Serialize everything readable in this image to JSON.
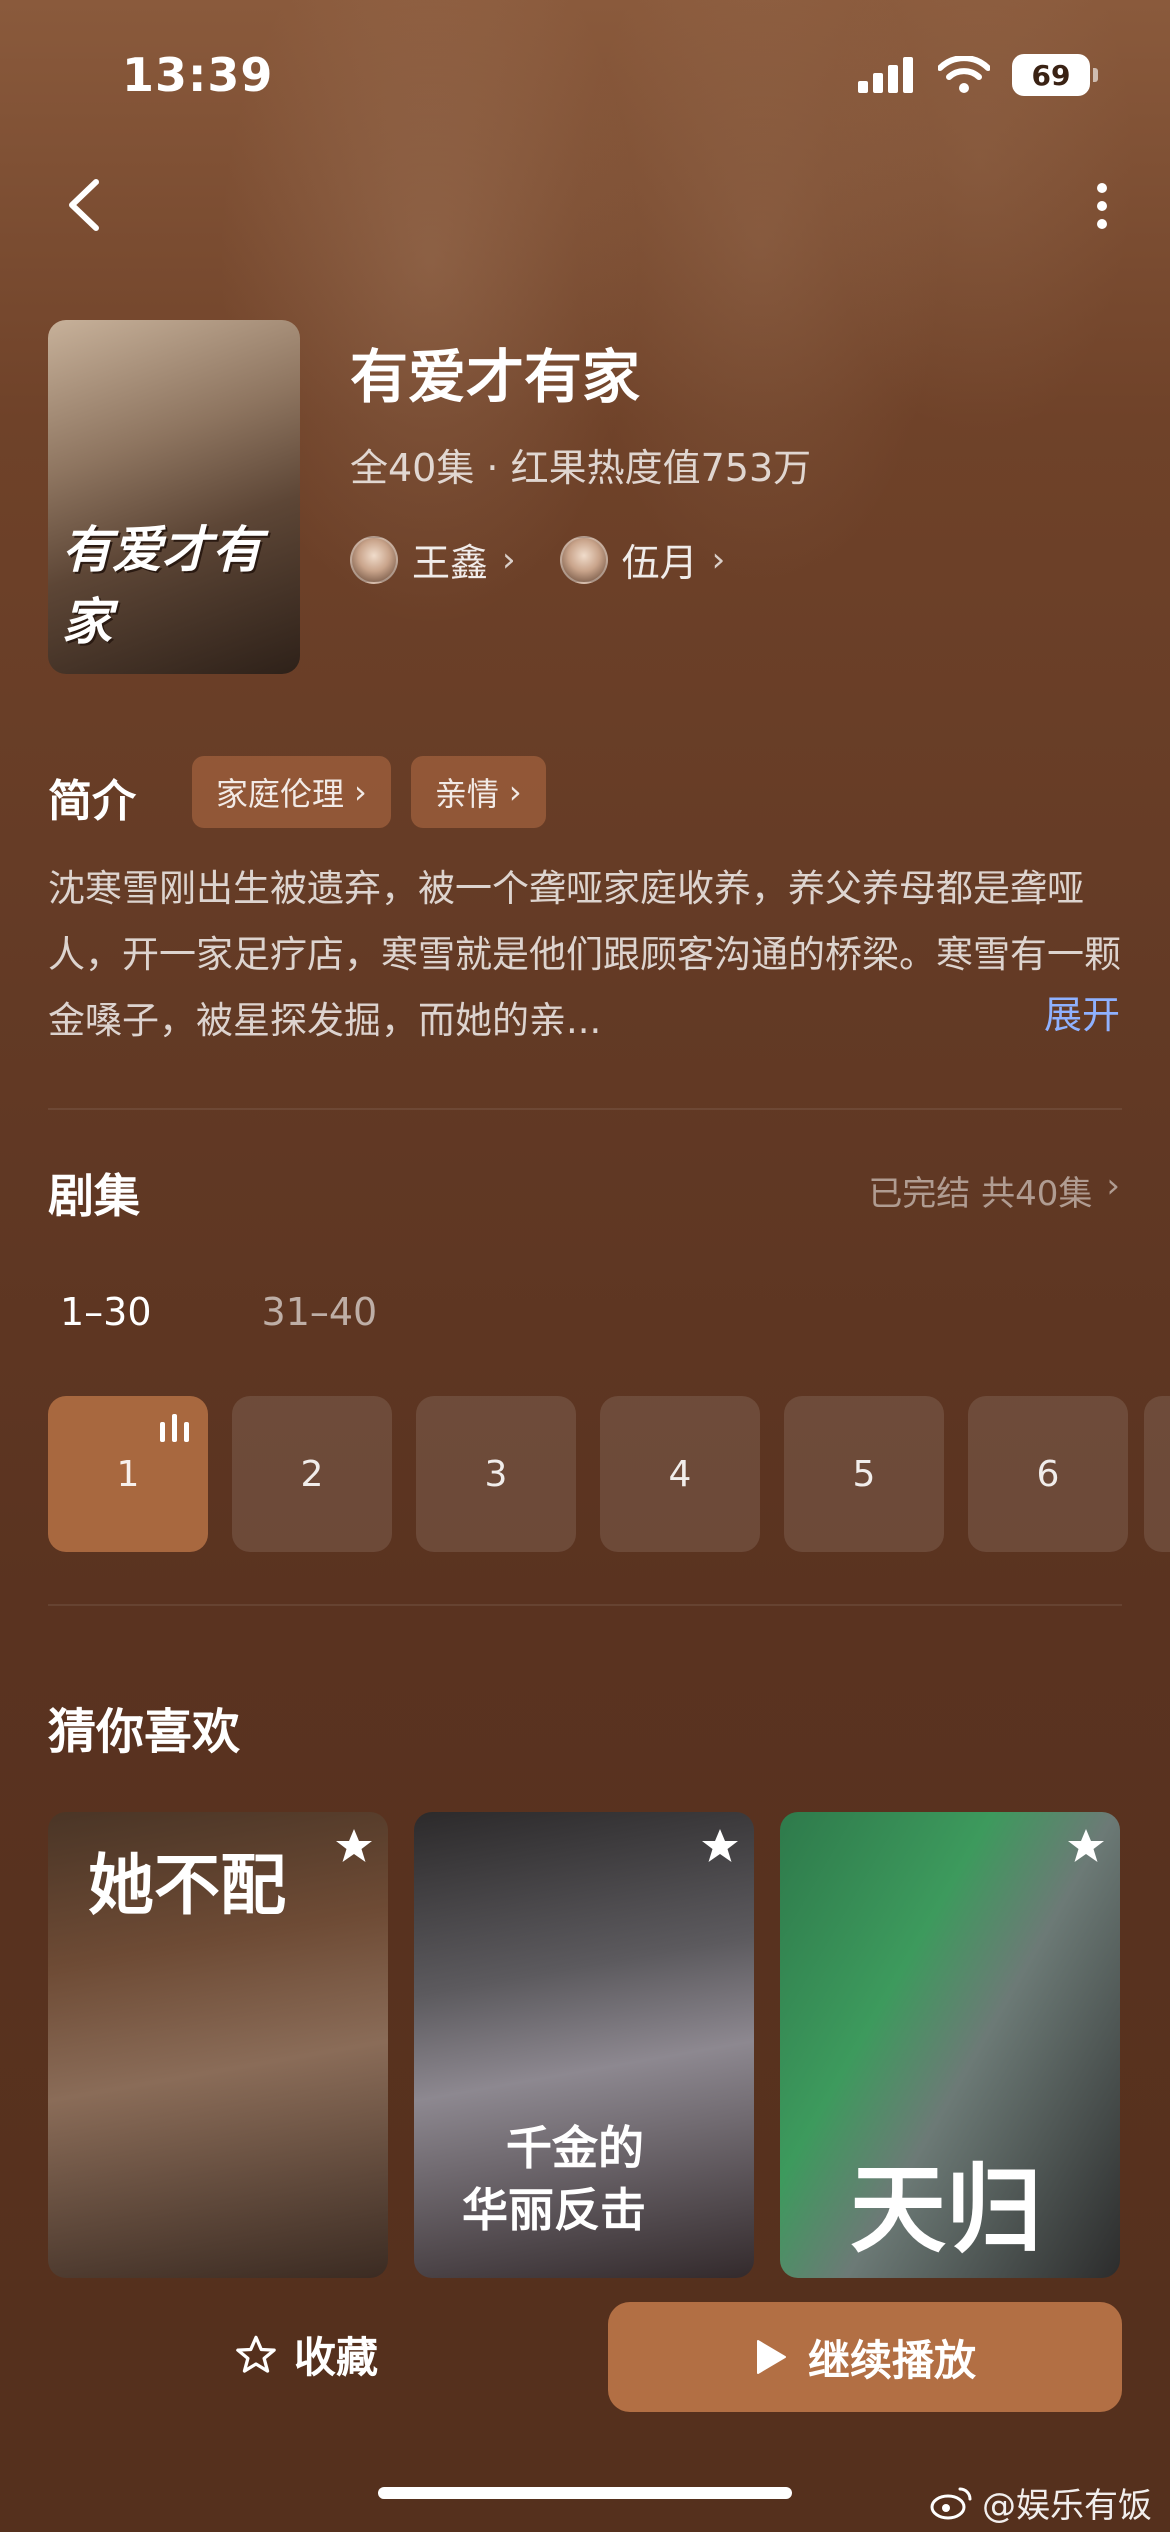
{
  "status_bar": {
    "time": "13:39",
    "battery": "69"
  },
  "drama": {
    "title": "有爱才有家",
    "meta": "全40集 · 红果热度值753万",
    "cover_title": "有爱才有家",
    "actors": [
      {
        "name": "王鑫"
      },
      {
        "name": "伍月"
      }
    ]
  },
  "intro": {
    "heading": "简介",
    "tags": [
      {
        "label": "家庭伦理"
      },
      {
        "label": "亲情"
      }
    ],
    "description": "沈寒雪刚出生被遗弃，被一个聋哑家庭收养，养父养母都是聋哑人，开一家足疗店，寒雪就是他们跟顾客沟通的桥梁。寒雪有一颗金嗓子，被星探发掘，而她的亲...",
    "expand_label": "展开"
  },
  "episodes": {
    "heading": "剧集",
    "status": "已完结 共40集",
    "ranges": [
      {
        "label": "1–30",
        "active": true
      },
      {
        "label": "31–40",
        "active": false
      }
    ],
    "items": [
      {
        "label": "1",
        "active": true
      },
      {
        "label": "2",
        "active": false
      },
      {
        "label": "3",
        "active": false
      },
      {
        "label": "4",
        "active": false
      },
      {
        "label": "5",
        "active": false
      },
      {
        "label": "6",
        "active": false
      }
    ]
  },
  "recommend": {
    "heading": "猜你喜欢",
    "items": [
      {
        "poster_text": "她不配"
      },
      {
        "poster_text_line1": "千金的",
        "poster_text_line2": "华丽反击"
      },
      {
        "poster_text": "天归"
      }
    ]
  },
  "bottom_bar": {
    "favorite_label": "收藏",
    "play_label": "继续播放"
  },
  "watermark": "@娱乐有饭",
  "icons": {
    "back": "chevron-left-icon",
    "more": "more-vertical-icon",
    "favorite": "star-outline-icon",
    "play": "play-icon",
    "playing": "equalizer-icon",
    "weibo": "weibo-logo-icon"
  },
  "colors": {
    "accent": "#b26f44",
    "episode_active": "#a8683f",
    "expand_link": "#8fb1ff",
    "background": "#5a3320"
  }
}
